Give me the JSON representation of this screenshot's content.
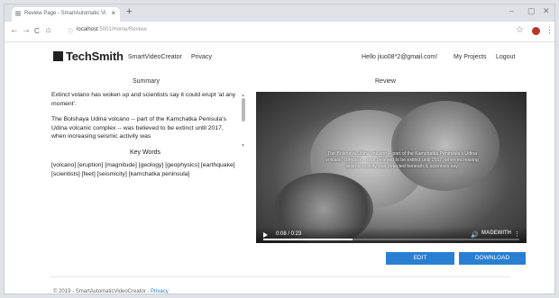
{
  "browser": {
    "tab_title": "Review Page - SmartAutomatic Vi",
    "tab_close": "×",
    "new_tab": "+",
    "url_host": "localhost",
    "url_path": ":5001/Home/Review",
    "back": "←",
    "forward": "→",
    "reload": "C",
    "home": "⌂"
  },
  "nav": {
    "logo": "TechSmith",
    "smart_video_creator": "SmartVideoCreator",
    "privacy": "Privacy",
    "greeting": "Hello jiuo08*2@gmail.com!",
    "my_projects": "My Projects",
    "logout": "Logout"
  },
  "summary": {
    "heading": "Summary",
    "para1": "Extinct volano has woken up and scientists say it could erupt 'at any moment'.",
    "para2": "The Bolshaya Udina volcano -- part of the Kamchatka Penisula's Udina volcanic complex -- was believed to be extinct until 2017, when increasing seismic activity was",
    "keywords_heading": "Key Words",
    "keywords": "[volcano] [eruption] [magnitude] [geology] [geophysics] [earthquake] [scientists] [feet] [seismicity] [kamchatka peninsula]"
  },
  "review": {
    "heading": "Review",
    "caption": "The Bolshaya Udina volcano -- part of the Kamchatka Peninsula's Udina volcanic complex -- was believed to be extinct until 2017, when increasing seismic activity was detected beneath it, scientists say.",
    "time": "0:08 / 0:23",
    "progress": 0.35,
    "watermark": "MADEWITH"
  },
  "buttons": {
    "edit": "EDIT",
    "download": "DOWNLOAD"
  },
  "footer": {
    "copyright": "© 2019 - SmartAutomaticVideoCreator -",
    "privacy": "Privacy"
  },
  "colors": {
    "accent": "#2a7fd3"
  }
}
